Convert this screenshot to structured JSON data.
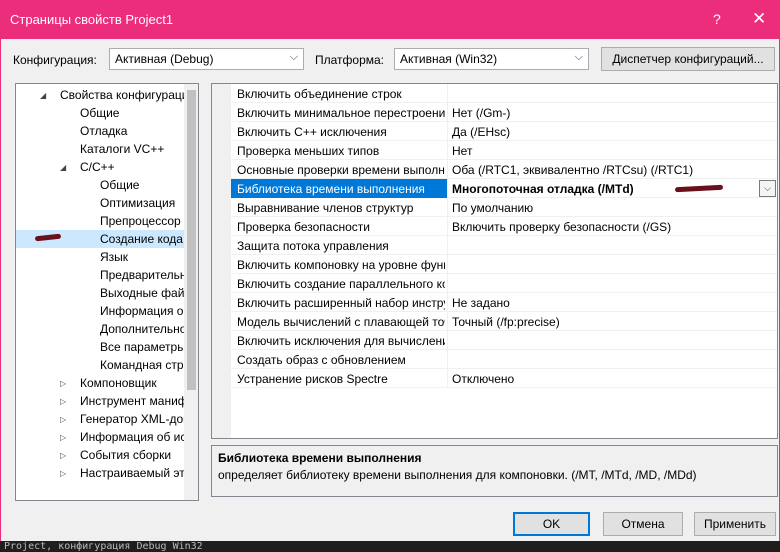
{
  "window": {
    "title": "Страницы свойств Project1",
    "help": "?",
    "close": "✕"
  },
  "toolbar": {
    "config_label": "Конфигурация:",
    "config_value": "Активная (Debug)",
    "platform_label": "Платформа:",
    "platform_value": "Активная (Win32)",
    "config_manager": "Диспетчер конфигураций..."
  },
  "tree": [
    {
      "label": "Свойства конфигурации",
      "level": 0,
      "expander": "◢"
    },
    {
      "label": "Общие",
      "level": 1,
      "expander": ""
    },
    {
      "label": "Отладка",
      "level": 1,
      "expander": ""
    },
    {
      "label": "Каталоги VC++",
      "level": 1,
      "expander": ""
    },
    {
      "label": "C/C++",
      "level": 1,
      "expander": "◢"
    },
    {
      "label": "Общие",
      "level": 2,
      "expander": ""
    },
    {
      "label": "Оптимизация",
      "level": 2,
      "expander": ""
    },
    {
      "label": "Препроцессор",
      "level": 2,
      "expander": ""
    },
    {
      "label": "Создание кода",
      "level": 2,
      "expander": "",
      "selected": true
    },
    {
      "label": "Язык",
      "level": 2,
      "expander": ""
    },
    {
      "label": "Предварительно ст",
      "level": 2,
      "expander": ""
    },
    {
      "label": "Выходные файлы",
      "level": 2,
      "expander": ""
    },
    {
      "label": "Информация об ис",
      "level": 2,
      "expander": ""
    },
    {
      "label": "Дополнительно",
      "level": 2,
      "expander": ""
    },
    {
      "label": "Все параметры",
      "level": 2,
      "expander": ""
    },
    {
      "label": "Командная строка",
      "level": 2,
      "expander": ""
    },
    {
      "label": "Компоновщик",
      "level": 1,
      "expander": "▷"
    },
    {
      "label": "Инструмент манифест",
      "level": 1,
      "expander": "▷"
    },
    {
      "label": "Генератор XML-докум",
      "level": 1,
      "expander": "▷"
    },
    {
      "label": "Информация об исход",
      "level": 1,
      "expander": "▷"
    },
    {
      "label": "События сборки",
      "level": 1,
      "expander": "▷"
    },
    {
      "label": "Настраиваемый этап с",
      "level": 1,
      "expander": "▷"
    }
  ],
  "properties": [
    {
      "name": "Включить объединение строк",
      "value": ""
    },
    {
      "name": "Включить минимальное перестроение",
      "value": "Нет (/Gm-)"
    },
    {
      "name": "Включить C++ исключения",
      "value": "Да (/EHsc)"
    },
    {
      "name": "Проверка меньших типов",
      "value": "Нет"
    },
    {
      "name": "Основные проверки времени выполнения",
      "value": "Оба (/RTC1, эквивалентно /RTCsu) (/RTC1)"
    },
    {
      "name": "Библиотека времени выполнения",
      "value": "Многопоточная отладка (/MTd)",
      "selected": true
    },
    {
      "name": "Выравнивание членов структур",
      "value": "По умолчанию"
    },
    {
      "name": "Проверка безопасности",
      "value": "Включить проверку безопасности (/GS)"
    },
    {
      "name": "Защита потока управления",
      "value": ""
    },
    {
      "name": "Включить компоновку на уровне функций",
      "value": ""
    },
    {
      "name": "Включить создание параллельного кода",
      "value": ""
    },
    {
      "name": "Включить расширенный набор инструкций",
      "value": "Не задано"
    },
    {
      "name": "Модель вычислений с плавающей точкой",
      "value": "Точный (/fp:precise)"
    },
    {
      "name": "Включить исключения для вычислений",
      "value": ""
    },
    {
      "name": "Создать образ с обновлением",
      "value": ""
    },
    {
      "name": "Устранение рисков Spectre",
      "value": "Отключено"
    }
  ],
  "description": {
    "title": "Библиотека времени выполнения",
    "text": "определяет библиотеку времени выполнения для компоновки.     (/MT, /MTd, /MD, /MDd)"
  },
  "buttons": {
    "ok": "OK",
    "cancel": "Отмена",
    "apply": "Применить"
  },
  "footer_text": "Project, конфигурация Debug Win32",
  "colors": {
    "titlebar": "#ec2d7c",
    "selection": "#0078d7",
    "annotation_mark": "#6b0f1a"
  }
}
